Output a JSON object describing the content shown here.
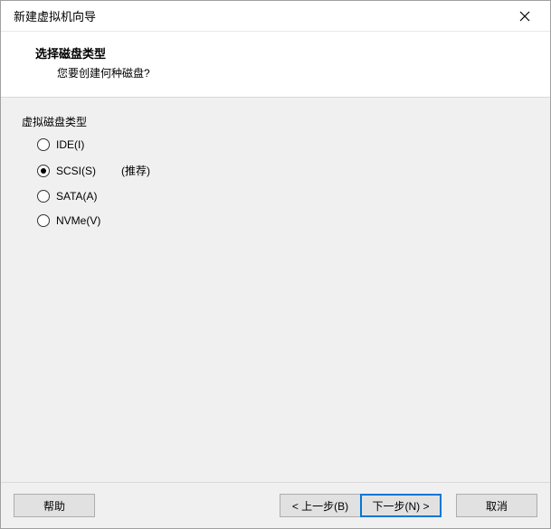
{
  "titlebar": {
    "title": "新建虚拟机向导"
  },
  "header": {
    "title": "选择磁盘类型",
    "subtitle": "您要创建何种磁盘?"
  },
  "group": {
    "label": "虚拟磁盘类型"
  },
  "options": {
    "ide": {
      "label": "IDE(I)"
    },
    "scsi": {
      "label": "SCSI(S)",
      "recommend": "(推荐)"
    },
    "sata": {
      "label": "SATA(A)"
    },
    "nvme": {
      "label": "NVMe(V)"
    },
    "selected": "scsi"
  },
  "buttons": {
    "help": "帮助",
    "back": "< 上一步(B)",
    "next": "下一步(N) >",
    "cancel": "取消"
  }
}
